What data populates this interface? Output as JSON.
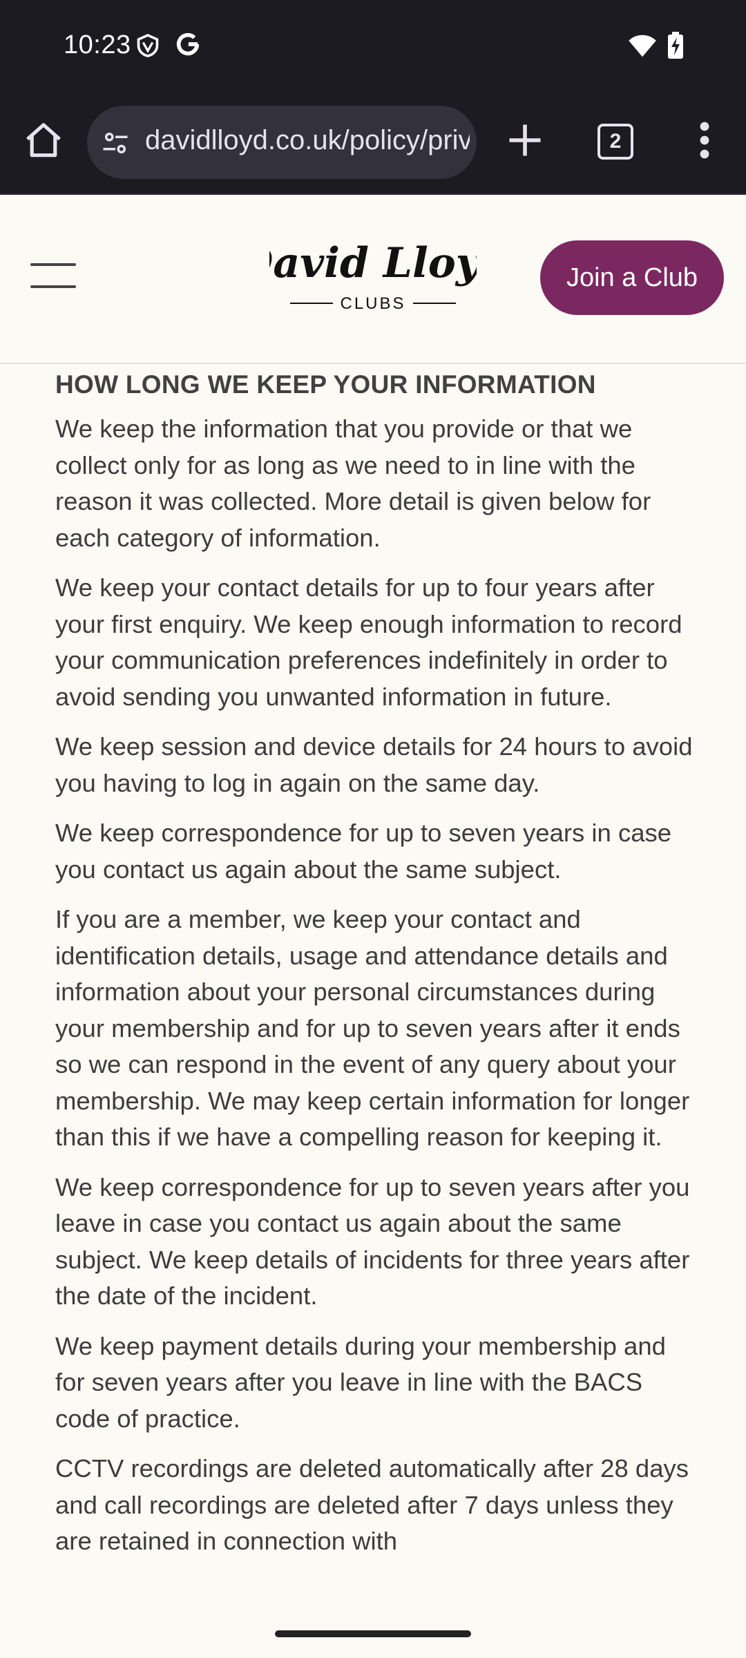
{
  "status_bar": {
    "time": "10:23",
    "icons": [
      "vpn-shield-icon",
      "google-icon",
      "wifi-icon",
      "battery-charging-icon"
    ]
  },
  "browser": {
    "url": "davidlloyd.co.uk/policy/privacy",
    "tab_count": "2",
    "icons": [
      "home-icon",
      "site-settings-icon",
      "plus-icon",
      "tabs-icon",
      "more-vert-icon"
    ]
  },
  "site_header": {
    "logo_script": "David Lloyd",
    "logo_sub": "CLUBS",
    "join_label": "Join a Club",
    "accent_color": "#7b2860"
  },
  "content": {
    "heading": "HOW LONG WE KEEP YOUR INFORMATION",
    "paragraphs": [
      "We keep the information that you provide or that we collect only for as long as we need to in line with the reason it was collected. More detail is given below for each category of information.",
      "We keep your contact details for up to four years after your first enquiry. We keep enough information to record your communication preferences indefinitely in order to avoid sending you unwanted information in future.",
      "We keep session and device details for 24 hours to avoid you having to log in again on the same day.",
      "We keep correspondence for up to seven years in case you contact us again about the same subject.",
      "If you are a member, we keep your contact and identification details, usage and attendance details and information about your personal circumstances during your membership and for up to seven years after it ends so we can respond in the event of any query about your membership. We may keep certain information for longer than this if we have a compelling reason for keeping it.",
      "We keep correspondence for up to seven years after you leave in case you contact us again about the same subject. We keep details of incidents for three years after the date of the incident.",
      "We keep payment details during your membership and for seven years after you leave in line with the BACS code of practice.",
      "CCTV recordings are deleted automatically after 28 days and call recordings are deleted after 7 days unless they are retained in connection with"
    ]
  }
}
